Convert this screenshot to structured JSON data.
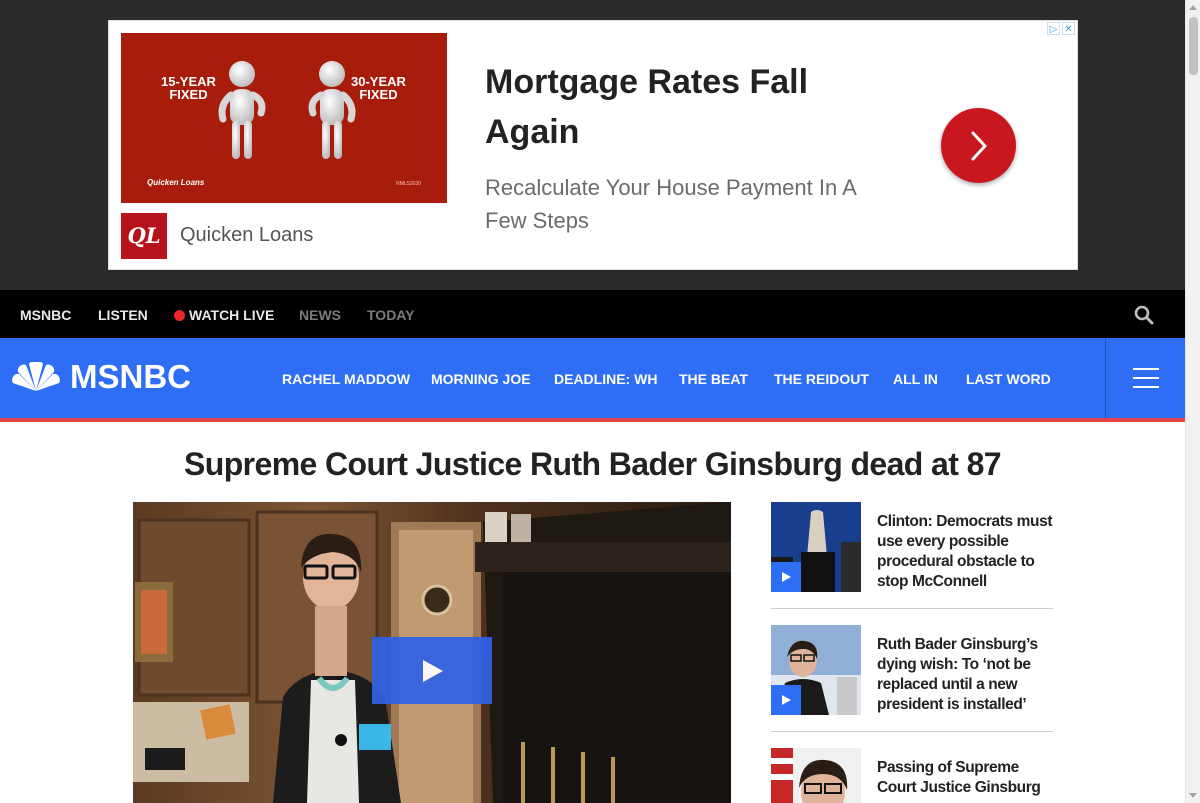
{
  "ad": {
    "badge": {
      "adchoices_icon": "adchoices-icon",
      "close_icon": "close-icon",
      "adchoices_glyph": "▷",
      "close_glyph": "✕"
    },
    "image": {
      "left_label_line1": "15-YEAR",
      "left_label_line2": "FIXED",
      "right_label_line1": "30-YEAR",
      "right_label_line2": "FIXED",
      "brand_text": "Quicken Loans",
      "fine_print": "NMLS3030",
      "background_color": "#a81c0b"
    },
    "logo_text": "QL",
    "advertiser": "Quicken Loans",
    "headline": "Mortgage Rates Fall Again",
    "description": "Recalculate Your House Payment In A Few Steps",
    "cta_icon": "chevron-right-icon",
    "cta_color": "#c8171f"
  },
  "topnav": {
    "items": [
      {
        "label": "MSNBC"
      },
      {
        "label": "LISTEN"
      },
      {
        "label": "WATCH LIVE"
      },
      {
        "label": "NEWS"
      },
      {
        "label": "TODAY"
      }
    ],
    "search_icon": "search-icon"
  },
  "header": {
    "logo_text": "MSNBC",
    "logo_icon": "peacock-icon",
    "nav": [
      {
        "label": "RACHEL MADDOW"
      },
      {
        "label": "MORNING JOE"
      },
      {
        "label": "DEADLINE: WH"
      },
      {
        "label": "THE BEAT"
      },
      {
        "label": "THE REIDOUT"
      },
      {
        "label": "ALL IN"
      },
      {
        "label": "LAST WORD"
      }
    ],
    "menu_icon": "hamburger-icon",
    "brand_color": "#2d6ef5",
    "accent_color": "#e8424a"
  },
  "main": {
    "headline": "Supreme Court Justice Ruth Bader Ginsburg dead at 87",
    "hero_play_icon": "play-icon",
    "side_stories": [
      {
        "title": "Clinton: Democrats must use every possible procedural obstacle to stop McConnell",
        "has_video": true
      },
      {
        "title": "Ruth Bader Ginsburg’s dying wish: To ‘not be replaced until a new president is installed’",
        "has_video": true
      },
      {
        "title": "Passing of Supreme Court Justice Ginsburg",
        "has_video": false
      }
    ]
  }
}
